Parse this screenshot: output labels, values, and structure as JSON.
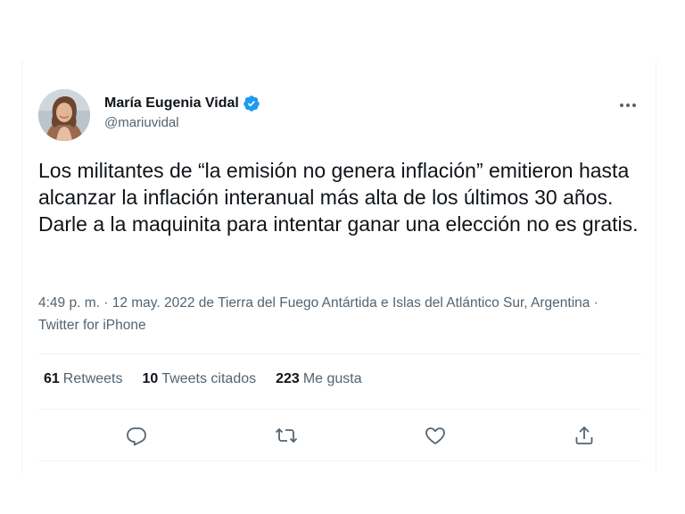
{
  "author": {
    "name": "María Eugenia Vidal",
    "handle": "@mariuvidal",
    "verified_color": "#1d9bf0"
  },
  "tweet": {
    "text": "Los militantes de “la emisión no genera inflación” emitieron hasta alcanzar la inflación interanual más alta de los últimos 30 años. Darle a la maquinita para intentar ganar una elección no es gratis."
  },
  "meta": {
    "time": "4:49 p. m.",
    "separator": " · ",
    "date": "12 may. 2022",
    "location_prefix": " de ",
    "location": "Tierra del Fuego Antártida e Islas del Atlántico Sur, Argentina",
    "source_separator": " · ",
    "source": "Twitter for iPhone"
  },
  "stats": {
    "retweets_count": "61",
    "retweets_label": "Retweets",
    "quotes_count": "10",
    "quotes_label": "Tweets citados",
    "likes_count": "223",
    "likes_label": "Me gusta"
  },
  "icons": {
    "more": "more-icon",
    "reply": "reply-icon",
    "retweet": "retweet-icon",
    "like": "like-icon",
    "share": "share-icon"
  }
}
